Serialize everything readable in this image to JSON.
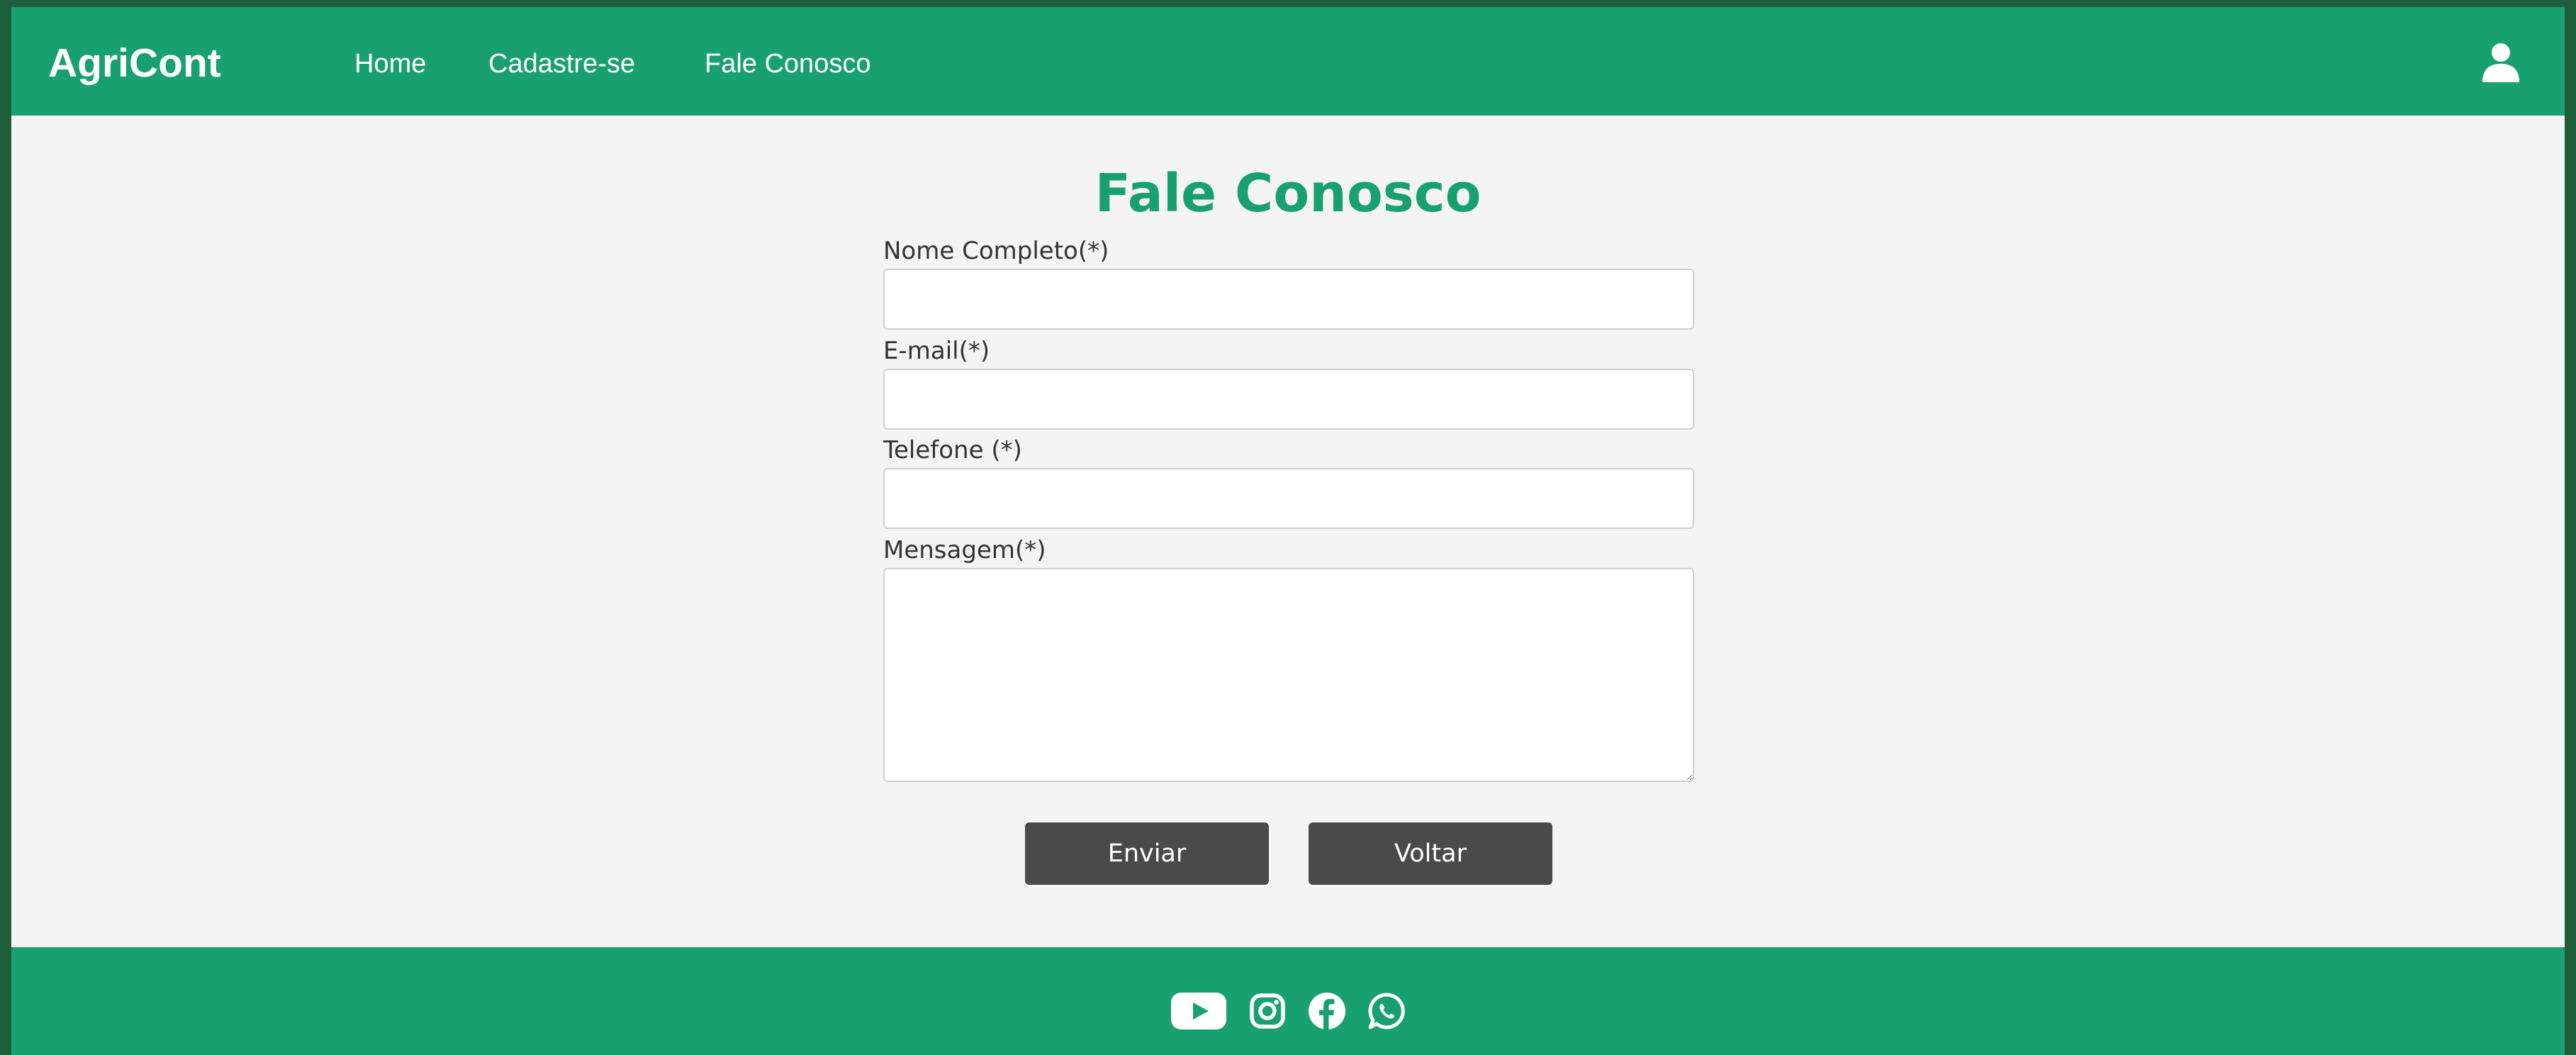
{
  "brand": "AgriCont",
  "nav": {
    "home": "Home",
    "register": "Cadastre-se",
    "contact": "Fale Conosco"
  },
  "page": {
    "title": "Fale Conosco"
  },
  "form": {
    "name_label": "Nome Completo(*)",
    "name_value": "",
    "email_label": "E-mail(*)",
    "email_value": "",
    "phone_label": "Telefone (*)",
    "phone_value": "",
    "message_label": "Mensagem(*)",
    "message_value": "",
    "submit_label": "Enviar",
    "back_label": "Voltar"
  },
  "footer": {
    "icons": [
      "youtube-icon",
      "instagram-icon",
      "facebook-icon",
      "whatsapp-icon"
    ]
  },
  "colors": {
    "primary": "#18a070",
    "page_background": "#f4f4f4",
    "outer_frame": "#1e5e3c",
    "button": "#4a4a4a",
    "text": "#333333"
  }
}
